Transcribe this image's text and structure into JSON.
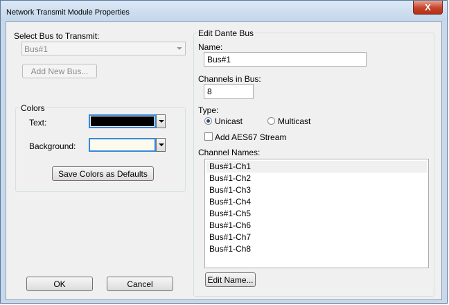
{
  "window": {
    "title": "Network Transmit Module Properties",
    "close_label": "X"
  },
  "bus": {
    "select_label": "Select Bus to Transmit:",
    "selected": "Bus#1",
    "add_new_label": "Add New Bus..."
  },
  "colors": {
    "group_title": "Colors",
    "text_label": "Text:",
    "background_label": "Background:",
    "text_color": "#000000",
    "background_color": "#fdfbee",
    "save_defaults_label": "Save Colors as Defaults"
  },
  "dante": {
    "group_title": "Edit Dante Bus",
    "name_label": "Name:",
    "name_value": "Bus#1",
    "channels_label": "Channels in Bus:",
    "channels_value": "8",
    "type_label": "Type:",
    "unicast_label": "Unicast",
    "multicast_label": "Multicast",
    "type_selected": "Unicast",
    "aes67_label": "Add AES67 Stream",
    "aes67_checked": false,
    "channel_names_label": "Channel Names:",
    "channel_names": [
      "Bus#1-Ch1",
      "Bus#1-Ch2",
      "Bus#1-Ch3",
      "Bus#1-Ch4",
      "Bus#1-Ch5",
      "Bus#1-Ch6",
      "Bus#1-Ch7",
      "Bus#1-Ch8"
    ],
    "edit_name_label": "Edit Name..."
  },
  "footer": {
    "ok_label": "OK",
    "cancel_label": "Cancel"
  }
}
